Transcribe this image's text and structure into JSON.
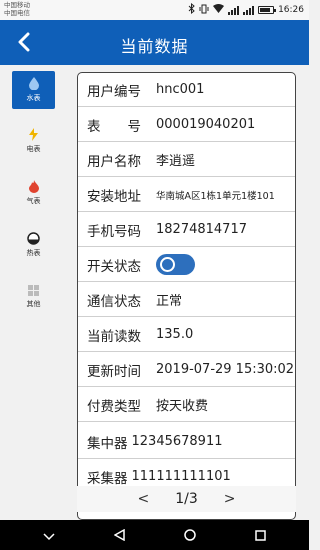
{
  "status_bar": {
    "carrier1": "中国移动",
    "carrier2": "中国电信",
    "time": "16:26",
    "battery_level": 0.85
  },
  "header": {
    "title": "当前数据"
  },
  "sidebar": {
    "items": [
      {
        "label": "水表",
        "icon": "water-drop-icon",
        "active": true
      },
      {
        "label": "电表",
        "icon": "lightning-icon",
        "active": false
      },
      {
        "label": "气表",
        "icon": "flame-icon",
        "active": false
      },
      {
        "label": "热表",
        "icon": "heat-gauge-icon",
        "active": false
      },
      {
        "label": "其他",
        "icon": "grid-icon",
        "active": false
      }
    ]
  },
  "details": {
    "rows": [
      {
        "label": "用户编号",
        "value": "hnc001"
      },
      {
        "label": "表　　号",
        "value": "000019040201"
      },
      {
        "label": "用户名称",
        "value": "李逍遥"
      },
      {
        "label": "安装地址",
        "value": "华南城A区1栋1单元1楼101"
      },
      {
        "label": "手机号码",
        "value": "18274814717"
      },
      {
        "label": "开关状态",
        "value": "on"
      },
      {
        "label": "通信状态",
        "value": "正常"
      },
      {
        "label": "当前读数",
        "value": "135.0"
      },
      {
        "label": "更新时间",
        "value": "2019-07-29 15:30:02"
      },
      {
        "label": "付费类型",
        "value": "按天收费"
      },
      {
        "label": "集中器",
        "value": "12345678911"
      },
      {
        "label": "采集器",
        "value": "111111111101"
      }
    ]
  },
  "pager": {
    "prev": "<",
    "current": "1/3",
    "next": ">"
  },
  "colors": {
    "brand": "#0f5fb8",
    "toggle": "#2d6fbd"
  }
}
